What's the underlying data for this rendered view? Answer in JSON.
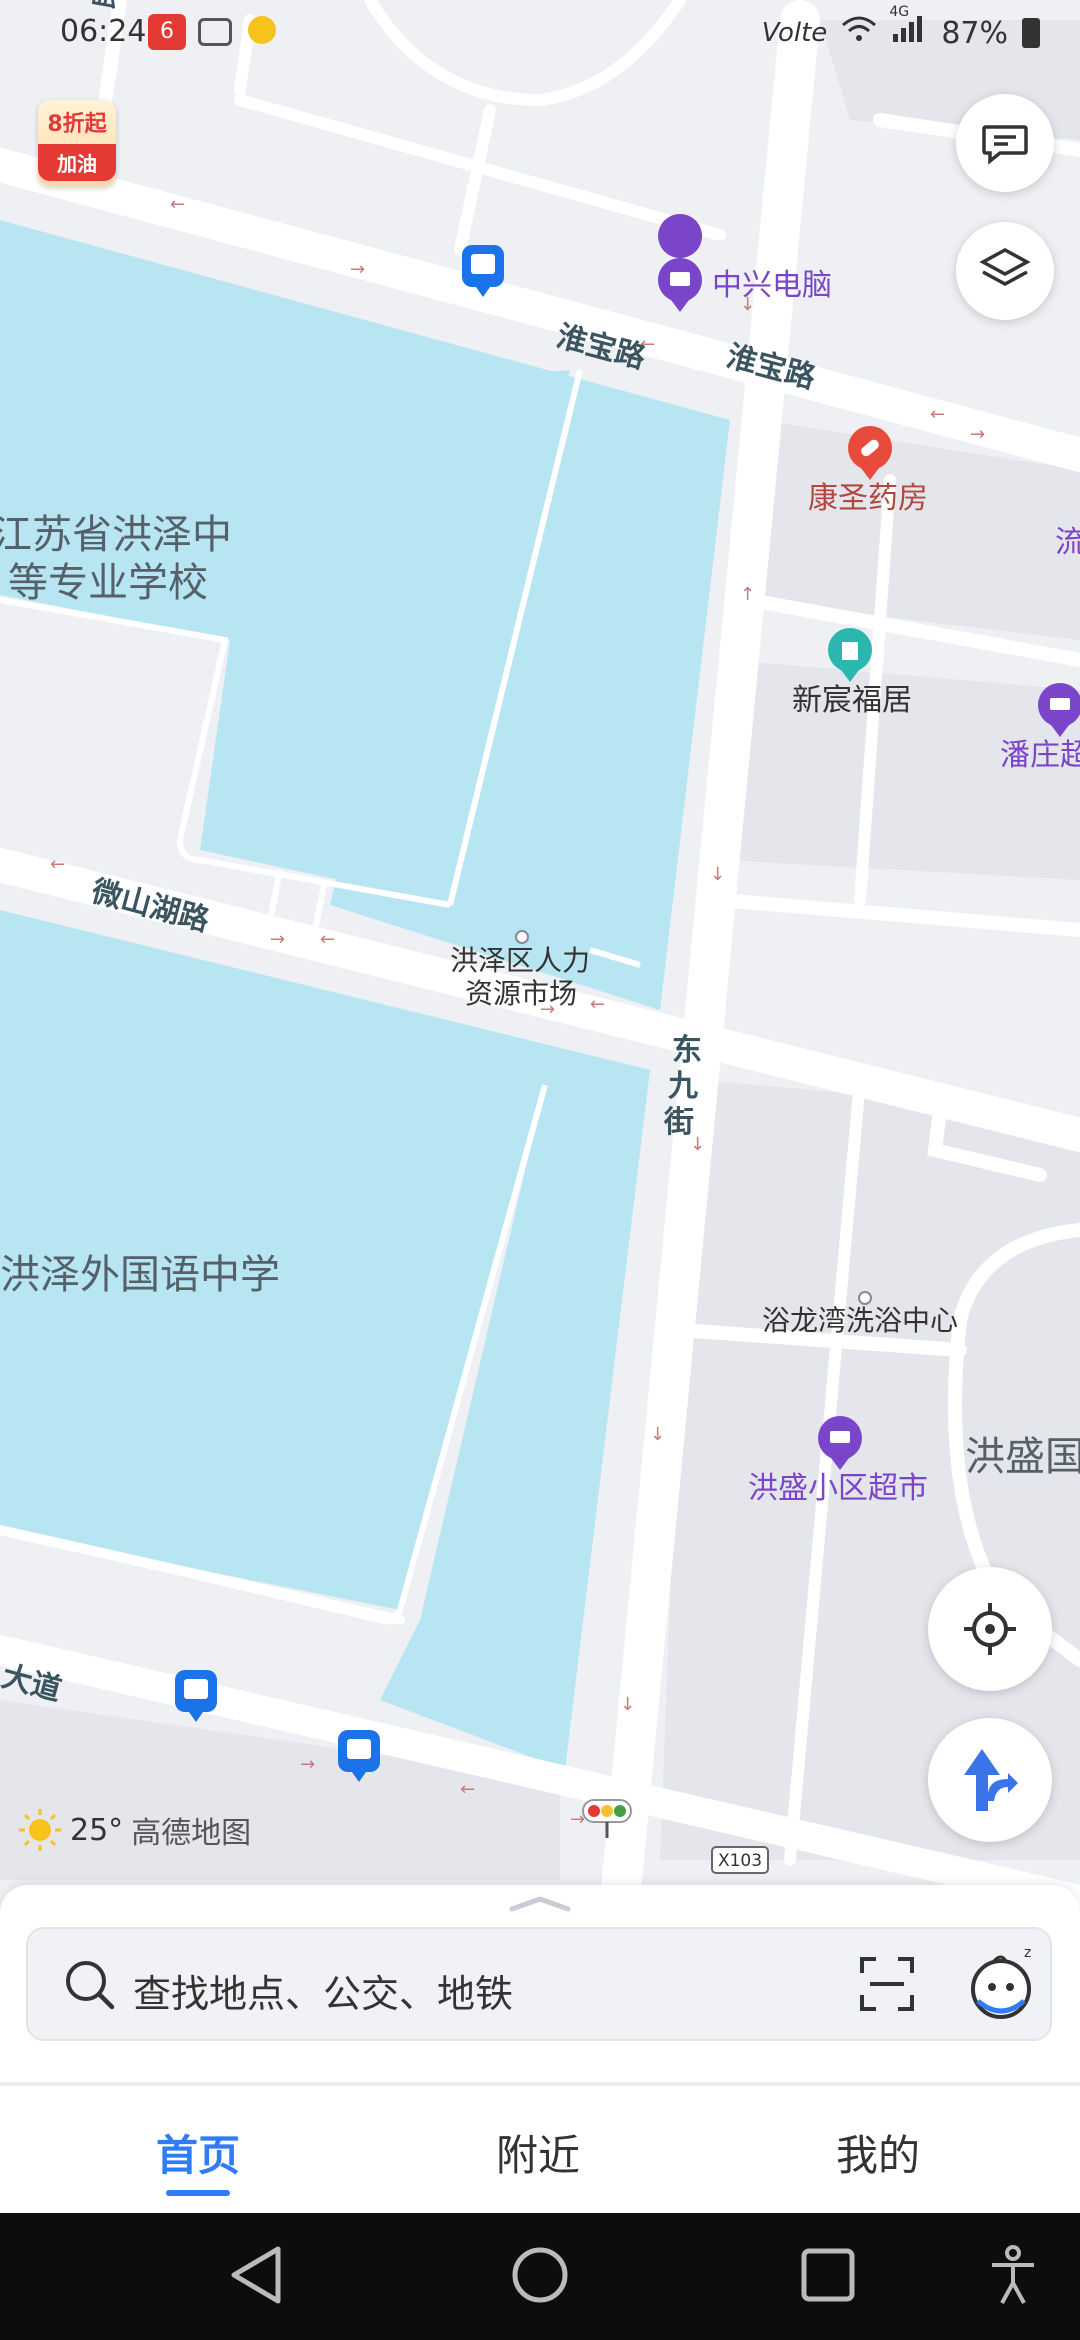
{
  "status_bar": {
    "time": "06:24",
    "notif_badge": "6",
    "network": "4G",
    "battery": "87%"
  },
  "map": {
    "roads": {
      "huaibao": "淮宝路",
      "weishanhu": "微山湖路",
      "dongjiu": "东九街",
      "dadao": "大道",
      "min": "民路",
      "x103": "X103"
    },
    "pois": {
      "zhongxing": "中兴电脑",
      "kangsheng": "康圣药房",
      "xinchen": "新宸福居",
      "panzhuang": "潘庄超",
      "liu": "流",
      "school1_line1": "江苏省洪泽中",
      "school1_line2": "等专业学校",
      "hr_line1": "洪泽区人力",
      "hr_line2": "资源市场",
      "school2": "洪泽外国语中学",
      "yulongwan": "浴龙湾洗浴中心",
      "hongsheng_market": "洪盛小区超市",
      "hongsheng_area": "洪盛国"
    },
    "colors": {
      "water": "#b7e6f2",
      "road": "#ffffff",
      "block": "#e4e6ec",
      "label": "#3a5560",
      "poi_purple": "#7b45c9",
      "poi_red": "#e84b3c",
      "poi_teal": "#2bb7b0",
      "bus_blue": "#1a73e8"
    }
  },
  "promo": {
    "top": "8折起",
    "bottom": "加油"
  },
  "weather": {
    "temp": "25°",
    "brand": "高德地图"
  },
  "search": {
    "placeholder": "查找地点、公交、地铁"
  },
  "tabs": {
    "home": "首页",
    "nearby": "附近",
    "mine": "我的"
  },
  "icons": {
    "message": "message-icon",
    "layers": "layers-icon",
    "locate": "locate-icon",
    "navigate": "navigate-arrow-icon",
    "search": "search-icon",
    "scan": "scan-icon",
    "assistant": "assistant-avatar-icon"
  }
}
